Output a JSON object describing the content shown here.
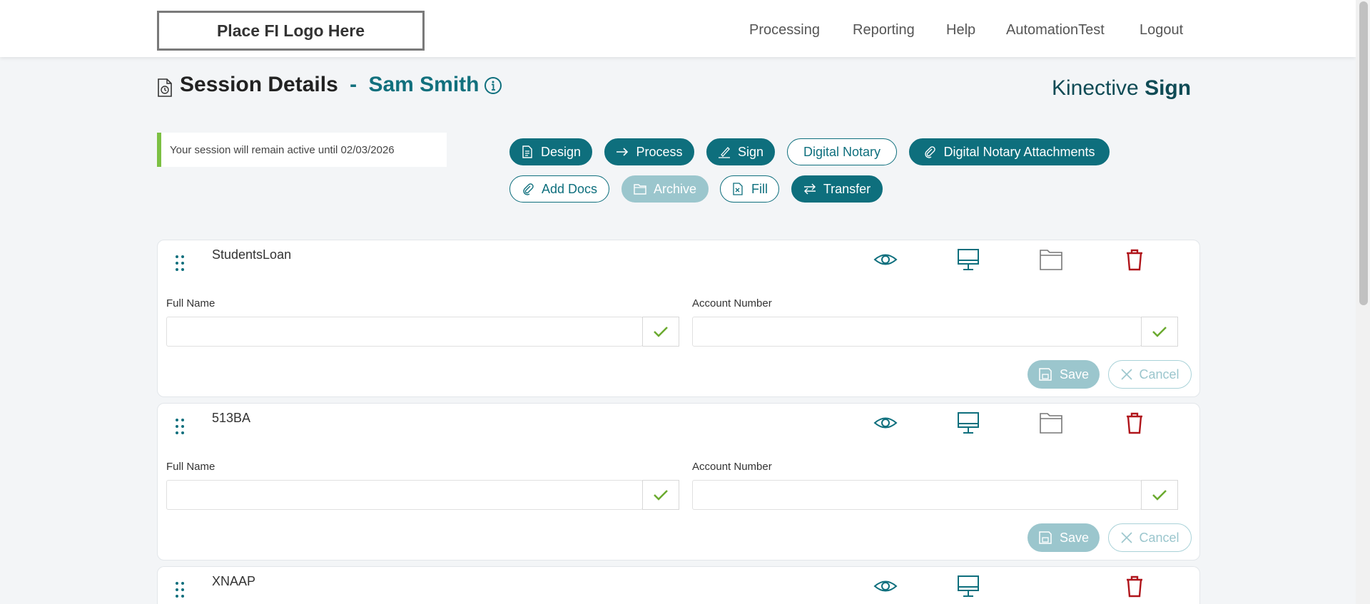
{
  "header": {
    "logo_text": "Place FI Logo Here",
    "nav": [
      "Processing",
      "Reporting",
      "Help",
      "AutomationTest",
      "Logout"
    ]
  },
  "page": {
    "title": "Session Details",
    "separator": "-",
    "customer_name": "Sam Smith",
    "brand_light": "Kinective",
    "brand_bold": "Sign",
    "session_notice": "Your session will remain active until 02/03/2026"
  },
  "actions": {
    "design": "Design",
    "process": "Process",
    "sign": "Sign",
    "digital_notary": "Digital Notary",
    "digital_notary_attachments": "Digital Notary Attachments",
    "add_docs": "Add Docs",
    "archive": "Archive",
    "fill": "Fill",
    "transfer": "Transfer"
  },
  "documents": [
    {
      "name": "StudentsLoan",
      "fields": [
        {
          "label": "Full Name",
          "value": ""
        },
        {
          "label": "Account Number",
          "value": ""
        }
      ],
      "save_label": "Save",
      "cancel_label": "Cancel"
    },
    {
      "name": "513BA",
      "fields": [
        {
          "label": "Full Name",
          "value": ""
        },
        {
          "label": "Account Number",
          "value": ""
        }
      ],
      "save_label": "Save",
      "cancel_label": "Cancel"
    },
    {
      "name": "XNAAP"
    }
  ],
  "colors": {
    "brand_teal": "#0e6f7d",
    "disabled_teal": "#9bc6cd",
    "delete_red": "#b0151b",
    "check_green": "#6aaa2e",
    "notice_green": "#7cc043"
  },
  "icons": {
    "view": "eye-icon",
    "preview": "monitor-icon",
    "folder": "folder-icon",
    "delete": "trash-icon"
  }
}
